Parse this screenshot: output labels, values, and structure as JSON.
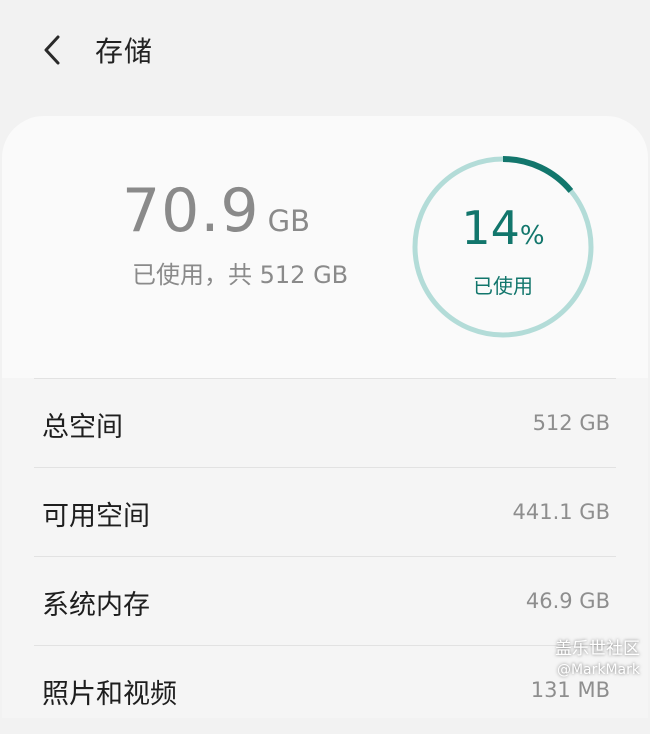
{
  "header": {
    "title": "存储",
    "back_icon": "chevron-left-icon"
  },
  "summary": {
    "used_number": "70.9",
    "used_unit": "GB",
    "caption": "已使用，共 512 GB",
    "ring": {
      "percent_number": "14",
      "percent_sign": "%",
      "label": "已使用",
      "fraction": 0.14,
      "color": "#12766c",
      "track_color": "#b3dcd8"
    }
  },
  "rows": [
    {
      "label": "总空间",
      "value": "512 GB"
    },
    {
      "label": "可用空间",
      "value": "441.1 GB"
    },
    {
      "label": "系统内存",
      "value": "46.9 GB"
    },
    {
      "label": "照片和视频",
      "value": "131 MB"
    }
  ],
  "watermark": {
    "title": "盖乐世社区",
    "user": "@MarkMark"
  }
}
